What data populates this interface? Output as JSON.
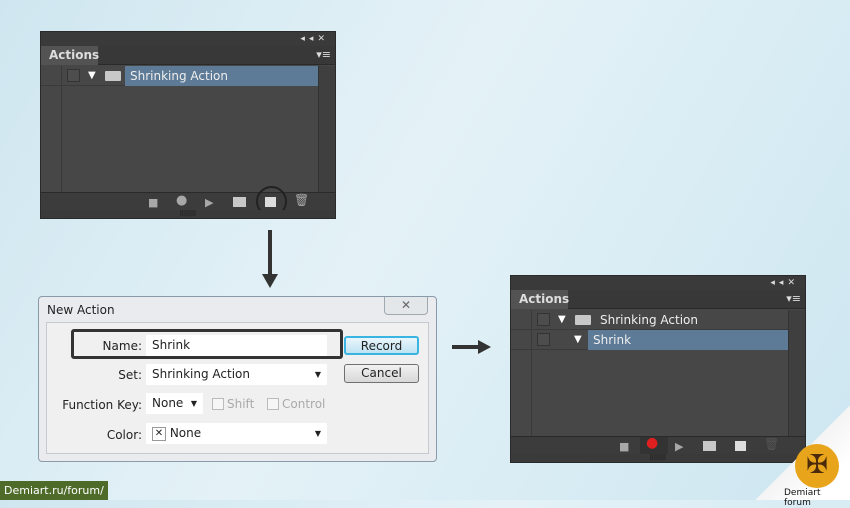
{
  "panel1": {
    "tab": "Actions",
    "rows": [
      {
        "label": "Shrinking Action",
        "type": "set",
        "selected": true
      }
    ]
  },
  "dialog": {
    "title": "New Action",
    "close": "✕",
    "name_label": "Name:",
    "name_value": "Shrink",
    "set_label": "Set:",
    "set_value": "Shrinking Action",
    "fkey_label": "Function Key:",
    "fkey_value": "None",
    "shift_label": "Shift",
    "control_label": "Control",
    "color_label": "Color:",
    "color_value": "None",
    "record": "Record",
    "cancel": "Cancel"
  },
  "panel2": {
    "tab": "Actions",
    "rows": [
      {
        "label": "Shrinking Action",
        "type": "set"
      },
      {
        "label": "Shrink",
        "type": "action",
        "selected": true
      }
    ],
    "recording": true
  },
  "watermark": {
    "url": "Demiart.ru/forum/",
    "logo_text": "Demiart forum"
  },
  "colors": {
    "selection": "#5d7a96",
    "record": "#e02020",
    "highlight": "#4fc3e8"
  }
}
